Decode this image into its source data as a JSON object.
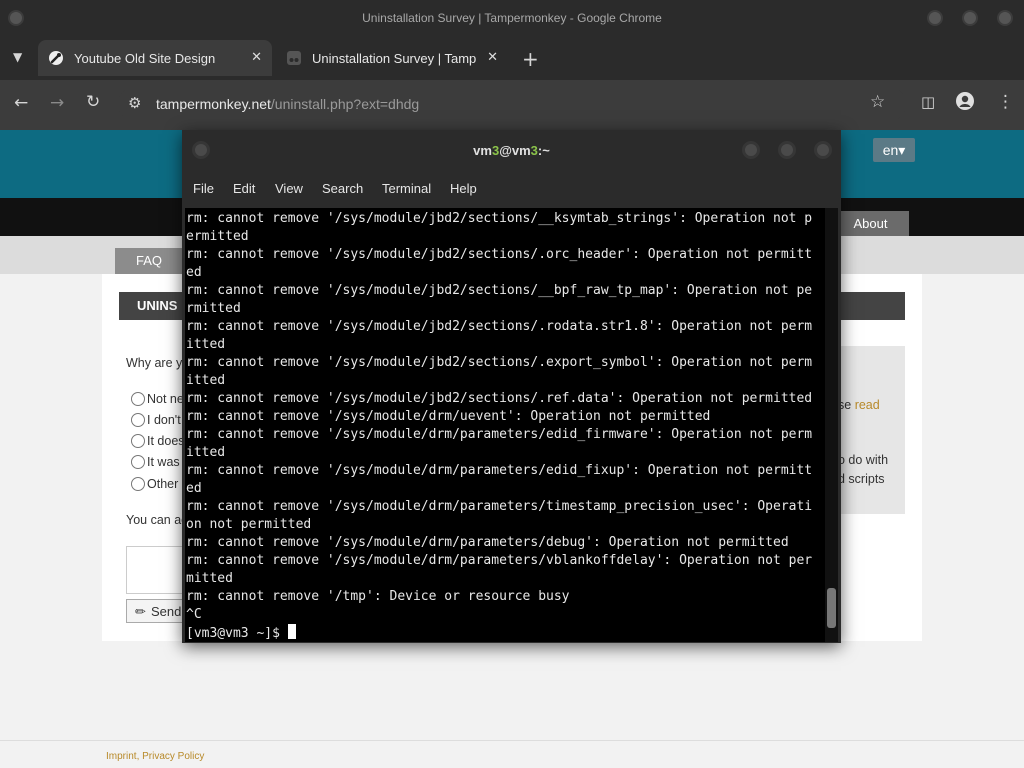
{
  "chrome": {
    "window_title": "Uninstallation Survey | Tampermonkey - Google Chrome",
    "tabs": [
      {
        "label": "Youtube Old Site Design",
        "active": true
      },
      {
        "label": "Uninstallation Survey | Tampe",
        "active": false
      }
    ],
    "url_host": "tampermonkey.net",
    "url_path": "/uninstall.php?ext=dhdg"
  },
  "page": {
    "lang": "en",
    "nav_about": "About",
    "tab_faq": "FAQ",
    "section_title": "UNINS",
    "question": "Why are y",
    "options": [
      "Not ne",
      "I don't",
      "It does",
      "It was",
      "Other"
    ],
    "note": "You can ac",
    "side_lines": [
      "se ",
      "o do with",
      "d scripts"
    ],
    "side_link": "read",
    "send_label": "Send",
    "footer_imprint": "Imprint",
    "footer_privacy": "Privacy Policy"
  },
  "terminal": {
    "title_parts": [
      "vm",
      "3",
      "@vm",
      "3",
      ":~"
    ],
    "menu": [
      "File",
      "Edit",
      "View",
      "Search",
      "Terminal",
      "Help"
    ],
    "lines": [
      "rm: cannot remove '/sys/module/jbd2/sections/__ksymtab_strings': Operation not p",
      "ermitted",
      "rm: cannot remove '/sys/module/jbd2/sections/.orc_header': Operation not permitt",
      "ed",
      "rm: cannot remove '/sys/module/jbd2/sections/__bpf_raw_tp_map': Operation not pe",
      "rmitted",
      "rm: cannot remove '/sys/module/jbd2/sections/.rodata.str1.8': Operation not perm",
      "itted",
      "rm: cannot remove '/sys/module/jbd2/sections/.export_symbol': Operation not perm",
      "itted",
      "rm: cannot remove '/sys/module/jbd2/sections/.ref.data': Operation not permitted",
      "rm: cannot remove '/sys/module/drm/uevent': Operation not permitted",
      "rm: cannot remove '/sys/module/drm/parameters/edid_firmware': Operation not perm",
      "itted",
      "rm: cannot remove '/sys/module/drm/parameters/edid_fixup': Operation not permitt",
      "ed",
      "rm: cannot remove '/sys/module/drm/parameters/timestamp_precision_usec': Operati",
      "on not permitted",
      "rm: cannot remove '/sys/module/drm/parameters/debug': Operation not permitted",
      "rm: cannot remove '/sys/module/drm/parameters/vblankoffdelay': Operation not per",
      "mitted",
      "rm: cannot remove '/tmp': Device or resource busy",
      "^C"
    ],
    "prompt": "[vm3@vm3 ~]$ "
  }
}
